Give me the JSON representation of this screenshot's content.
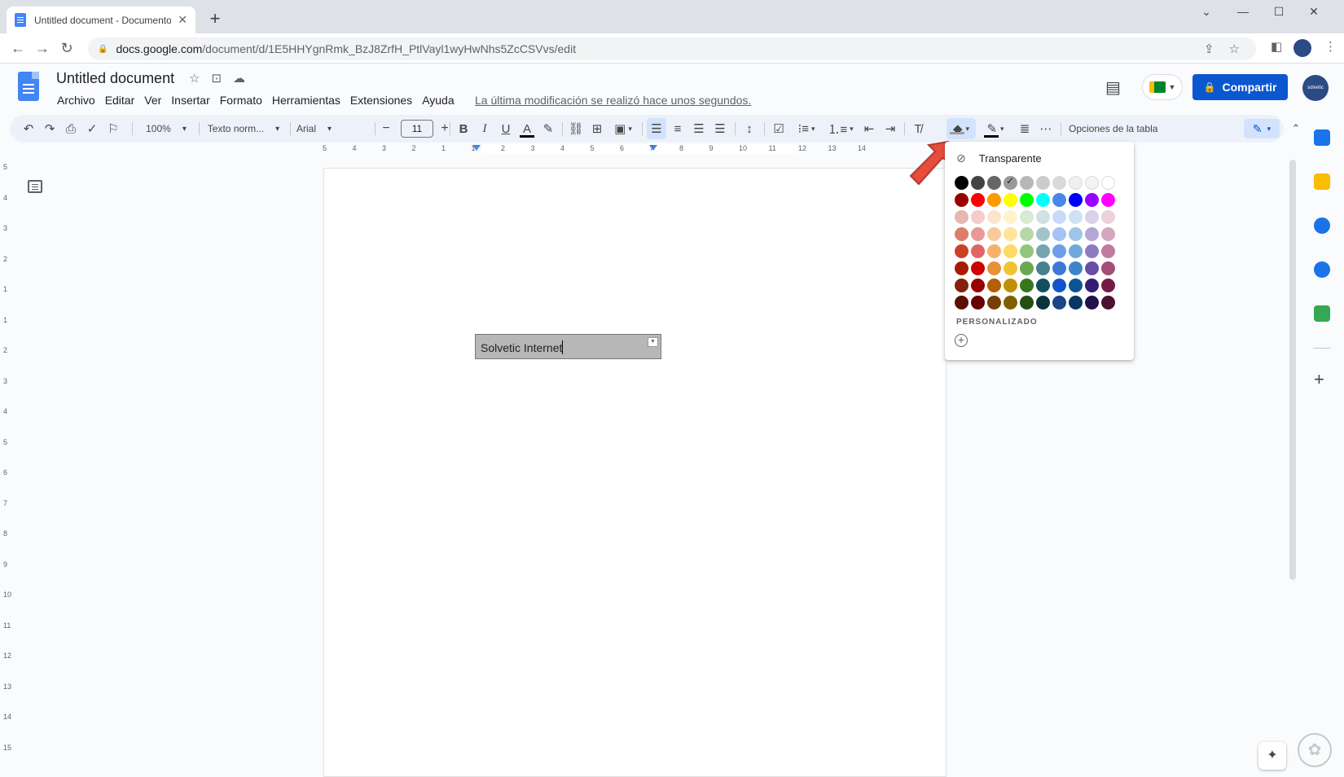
{
  "browser": {
    "tab_title": "Untitled document - Documento",
    "new_tab": "+",
    "url_host": "docs.google.com",
    "url_path": "/document/d/1E5HHYgnRmk_BzJ8ZrfH_PtlVayl1wyHwNhs5ZcCSVvs/edit"
  },
  "docs": {
    "title": "Untitled document",
    "menu": [
      "Archivo",
      "Editar",
      "Ver",
      "Insertar",
      "Formato",
      "Herramientas",
      "Extensiones",
      "Ayuda"
    ],
    "last_edit": "La última modificación se realizó hace unos segundos.",
    "share_label": "Compartir"
  },
  "toolbar": {
    "zoom": "100%",
    "style": "Texto norm...",
    "font": "Arial",
    "font_size": "11",
    "table_options": "Opciones de la tabla",
    "text_color": "#000000",
    "highlight_color": "#9e9e9e"
  },
  "ruler": {
    "labels": [
      "5",
      "4",
      "3",
      "2",
      "1",
      "1",
      "2",
      "3",
      "4",
      "5",
      "6",
      "7",
      "8",
      "9",
      "10",
      "11",
      "12",
      "13",
      "14"
    ],
    "vertical_labels": [
      "5",
      "4",
      "3",
      "2",
      "1",
      "1",
      "2",
      "3",
      "4",
      "5",
      "6",
      "7",
      "8",
      "9",
      "10",
      "11",
      "12",
      "13",
      "14",
      "15"
    ]
  },
  "document": {
    "cell_text": "Solvetic Internet"
  },
  "color_picker": {
    "transparent_label": "Transparente",
    "custom_label": "PERSONALIZADO",
    "selected_color": "#999999",
    "rows": [
      [
        "#000000",
        "#434343",
        "#666666",
        "#999999",
        "#b7b7b7",
        "#cccccc",
        "#d9d9d9",
        "#efefef",
        "#f3f3f3",
        "#ffffff"
      ],
      [
        "#980000",
        "#ff0000",
        "#ff9900",
        "#ffff00",
        "#00ff00",
        "#00ffff",
        "#4a86e8",
        "#0000ff",
        "#9900ff",
        "#ff00ff"
      ],
      [
        "#e6b8af",
        "#f4cccc",
        "#fce5cd",
        "#fff2cc",
        "#d9ead3",
        "#d0e0e3",
        "#c9daf8",
        "#cfe2f3",
        "#d9d2e9",
        "#ead1dc"
      ],
      [
        "#dd7e6b",
        "#ea9999",
        "#f9cb9c",
        "#ffe599",
        "#b6d7a8",
        "#a2c4c9",
        "#a4c2f4",
        "#9fc5e8",
        "#b4a7d6",
        "#d5a6bd"
      ],
      [
        "#cc4125",
        "#e06666",
        "#f6b26b",
        "#ffd966",
        "#93c47d",
        "#76a5af",
        "#6d9eeb",
        "#6fa8dc",
        "#8e7cc3",
        "#c27ba0"
      ],
      [
        "#a61c00",
        "#cc0000",
        "#e69138",
        "#f1c232",
        "#6aa84f",
        "#45818e",
        "#3c78d8",
        "#3d85c6",
        "#674ea7",
        "#a64d79"
      ],
      [
        "#85200c",
        "#990000",
        "#b45f06",
        "#bf9000",
        "#38761d",
        "#134f5c",
        "#1155cc",
        "#0b5394",
        "#351c75",
        "#741b47"
      ],
      [
        "#5b0f00",
        "#660000",
        "#783f04",
        "#7f6000",
        "#274e13",
        "#0c343d",
        "#1c4587",
        "#073763",
        "#20124d",
        "#4c1130"
      ]
    ]
  },
  "side_panel": {
    "icons": [
      "calendar-icon",
      "keep-icon",
      "tasks-icon",
      "contacts-icon",
      "maps-icon"
    ],
    "colors": [
      "#1a73e8",
      "#fbbc04",
      "#1a73e8",
      "#1a73e8",
      "#34a853"
    ]
  }
}
